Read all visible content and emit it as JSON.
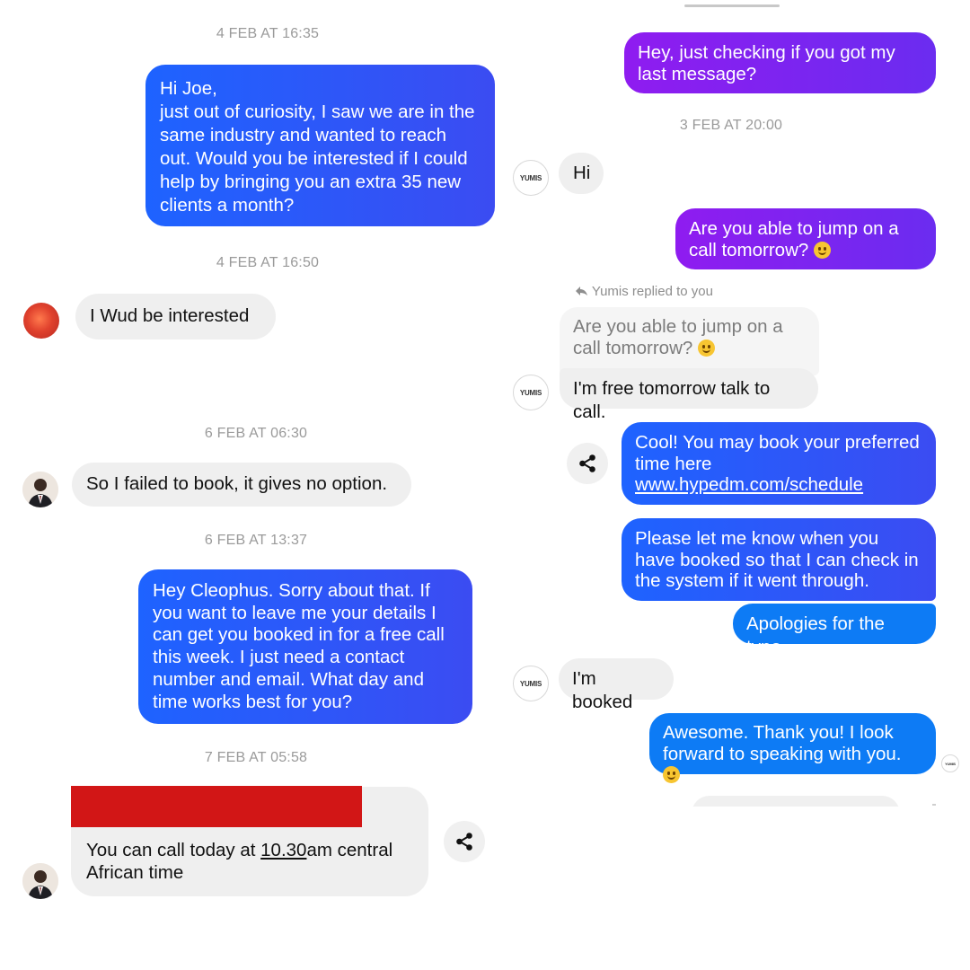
{
  "left": {
    "ts1": "4 FEB AT 16:35",
    "msg1": "Hi Joe,\njust out of curiosity, I saw we are in the same industry and wanted to reach out. Would you be interested if I could help by bringing you an extra 35 new clients a month?",
    "ts2": "4 FEB AT 16:50",
    "msg2": "I Wud be interested",
    "ts3": "6 FEB AT 06:30",
    "msg3": "So I failed to book, it gives no option.",
    "ts4": "6 FEB AT 13:37",
    "msg4": "Hey Cleophus. Sorry about that. If you want to leave me your details I can get you booked in for a free call this week. I just need a contact number and email. What day and time works best for you?",
    "ts5": "7 FEB AT 05:58",
    "msg5_pre": "You can call today at ",
    "msg5_link": "10.30",
    "msg5_post": "am central African time"
  },
  "right": {
    "msg1": "Hey, just checking if you got my last message?",
    "ts1": "3 FEB AT 20:00",
    "msg2": "Hi",
    "msg3": "Are you able to jump on a call tomorrow?",
    "reply_label": "Yumis replied to you",
    "quoted": "Are you able to jump on a call tomorrow?",
    "msg4": "I'm free tomorrow talk to call.",
    "msg5_pre": "Cool! You may book your preferred time here ",
    "msg5_link": "www.hypedm.com/schedule",
    "msg6": "Please let me know when you have booked so that I can check in the system if it went through.",
    "msg7": "Apologies for the typo",
    "msg8": "I'm booked",
    "msg9": "Awesome. Thank you! I look forward to speaking with you.",
    "logo_text": "YUMIS"
  },
  "colors": {
    "blue_gradient_start": "#1e63ff",
    "blue_gradient_end": "#3b4cf2",
    "purple_start": "#8f1cf0",
    "purple_end": "#6b2cf0",
    "azure": "#0d7bf5",
    "incoming_bg": "#efefef",
    "redaction": "#d21616"
  },
  "icons": {
    "share": "share-icon",
    "reply": "reply-arrow-icon",
    "emoji": "smiley-emoji-icon"
  }
}
